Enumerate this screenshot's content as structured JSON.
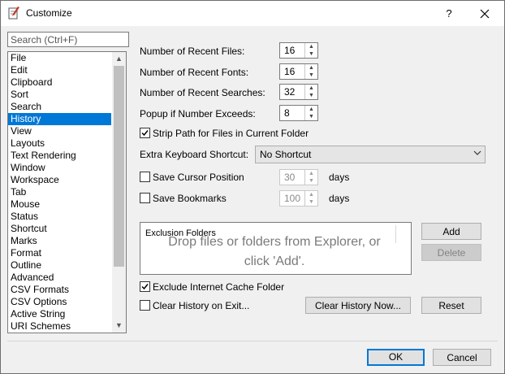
{
  "window": {
    "title": "Customize",
    "help_label": "?",
    "app_icon": "notepad-pen-icon",
    "close_icon": "close-icon"
  },
  "search": {
    "placeholder": "Search (Ctrl+F)",
    "value": ""
  },
  "categories": {
    "items": [
      "File",
      "Edit",
      "Clipboard",
      "Sort",
      "Search",
      "History",
      "View",
      "Layouts",
      "Text Rendering",
      "Window",
      "Workspace",
      "Tab",
      "Mouse",
      "Status",
      "Shortcut",
      "Marks",
      "Format",
      "Outline",
      "Advanced",
      "CSV Formats",
      "CSV Options",
      "Active String",
      "URI Schemes"
    ],
    "selected": "History",
    "scroll_up_icon": "chevron-up-icon",
    "scroll_down_icon": "chevron-down-icon"
  },
  "settings": {
    "recent_files": {
      "label": "Number of Recent Files:",
      "value": "16"
    },
    "recent_fonts": {
      "label": "Number of Recent Fonts:",
      "value": "16"
    },
    "recent_searches": {
      "label": "Number of Recent Searches:",
      "value": "32"
    },
    "popup_exceeds": {
      "label": "Popup if Number Exceeds:",
      "value": "8"
    },
    "strip_path": {
      "label": "Strip Path for Files in Current Folder",
      "checked": true
    },
    "extra_shortcut": {
      "label": "Extra Keyboard Shortcut:",
      "value": "No Shortcut"
    },
    "save_cursor": {
      "label": "Save Cursor Position",
      "checked": false,
      "value": "30",
      "unit": "days"
    },
    "save_bookmarks": {
      "label": "Save Bookmarks",
      "checked": false,
      "value": "100",
      "unit": "days"
    }
  },
  "exclusion": {
    "title": "Exclusion Folders",
    "hint_line1": "Drop files or folders from Explorer, or",
    "hint_line2": "click 'Add'.",
    "add_label": "Add",
    "delete_label": "Delete"
  },
  "bottom": {
    "exclude_cache": {
      "label": "Exclude Internet Cache Folder",
      "checked": true
    },
    "clear_on_exit": {
      "label": "Clear History on Exit...",
      "checked": false
    },
    "clear_now_label": "Clear History Now...",
    "reset_label": "Reset"
  },
  "footer": {
    "ok_label": "OK",
    "cancel_label": "Cancel"
  },
  "colors": {
    "selection": "#0078d7",
    "dialog_bg": "#f0f0f0",
    "default_button_border": "#0078d7"
  }
}
